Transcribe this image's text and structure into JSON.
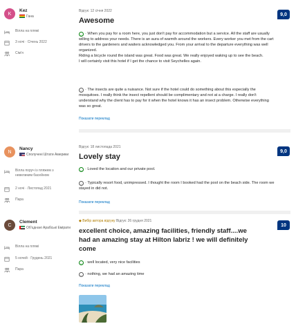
{
  "reviews": [
    {
      "user": {
        "initial": "K",
        "name": "Kez",
        "country": "Гана"
      },
      "meta": {
        "room": "Вілла на пляжі",
        "stay": "3 ночі · Січень 2022",
        "trip": "Сім'я"
      },
      "date": "Відгук: 12 січня 2022",
      "title": "Awesome",
      "score": "9,0",
      "positive": "· When you pay for a room here, you just don't pay for accommodation but a service. All the staff are usually willing to address your needs. There is an aura of warmth around the workers. Every worker you met from the cart drivers to the gardeners and waiters acknowledged you. From your arrival to the departure everything was well organized.",
      "positive2": "Riding a bicycle round the island was great. Food was great. We really enjoyed waking up to see the beach.",
      "positive3": "I will certainly visit this hotel if I get the chance to visit Seychelles again.",
      "negative": "· The insects are quite a nuisance. Not sure if the hotel could do something about this especially the mosquitoes. I really think the insect repellent should be complimentary and not at a charge. I really don't understand why the client has to pay for it when the hotel knows it has an insect problem. Otherwise everything was so great.",
      "translate": "Показати переклад"
    },
    {
      "user": {
        "initial": "N",
        "name": "Nancy",
        "country": "Сполучені Штати Америки"
      },
      "meta": {
        "room": "Вілла поруч із пляжем з невеликим басейном",
        "stay": "2 ночі · Листопад 2021",
        "trip": "Пара"
      },
      "date": "Відгук: 18 листопада 2021",
      "title": "Lovely stay",
      "score": "9,0",
      "positive": "· Loved the location and our private pool.",
      "negative": "· Typically resort food, unimpressed. I thought the room I booked had the pool on the beach side. The room we stayed in did not.",
      "translate": "Показати переклад"
    },
    {
      "user": {
        "initial": "C",
        "name": "Clement",
        "country": "Об'єднані Арабські Емірати"
      },
      "meta": {
        "room": "Вілла на пляжі",
        "stay": "5 ночей · Грудень 2021",
        "trip": "Пара"
      },
      "badge": "Вибір автора відгуку",
      "date": "Відгук: 26 грудня 2021",
      "title": "excellent choice, amazing facilities, friendly staff....we had an amazing stay at Hilton labriz ! we will definitely come",
      "score": "10",
      "positive": "· well located, very nice facilities",
      "negative": "· nothing, we had an amazing time",
      "translate": "Показати переклад"
    }
  ],
  "icons": {
    "positive": "smile-icon",
    "negative": "neutral-face-icon",
    "room": "bed-icon",
    "stay": "calendar-icon",
    "trip": "people-icon"
  }
}
